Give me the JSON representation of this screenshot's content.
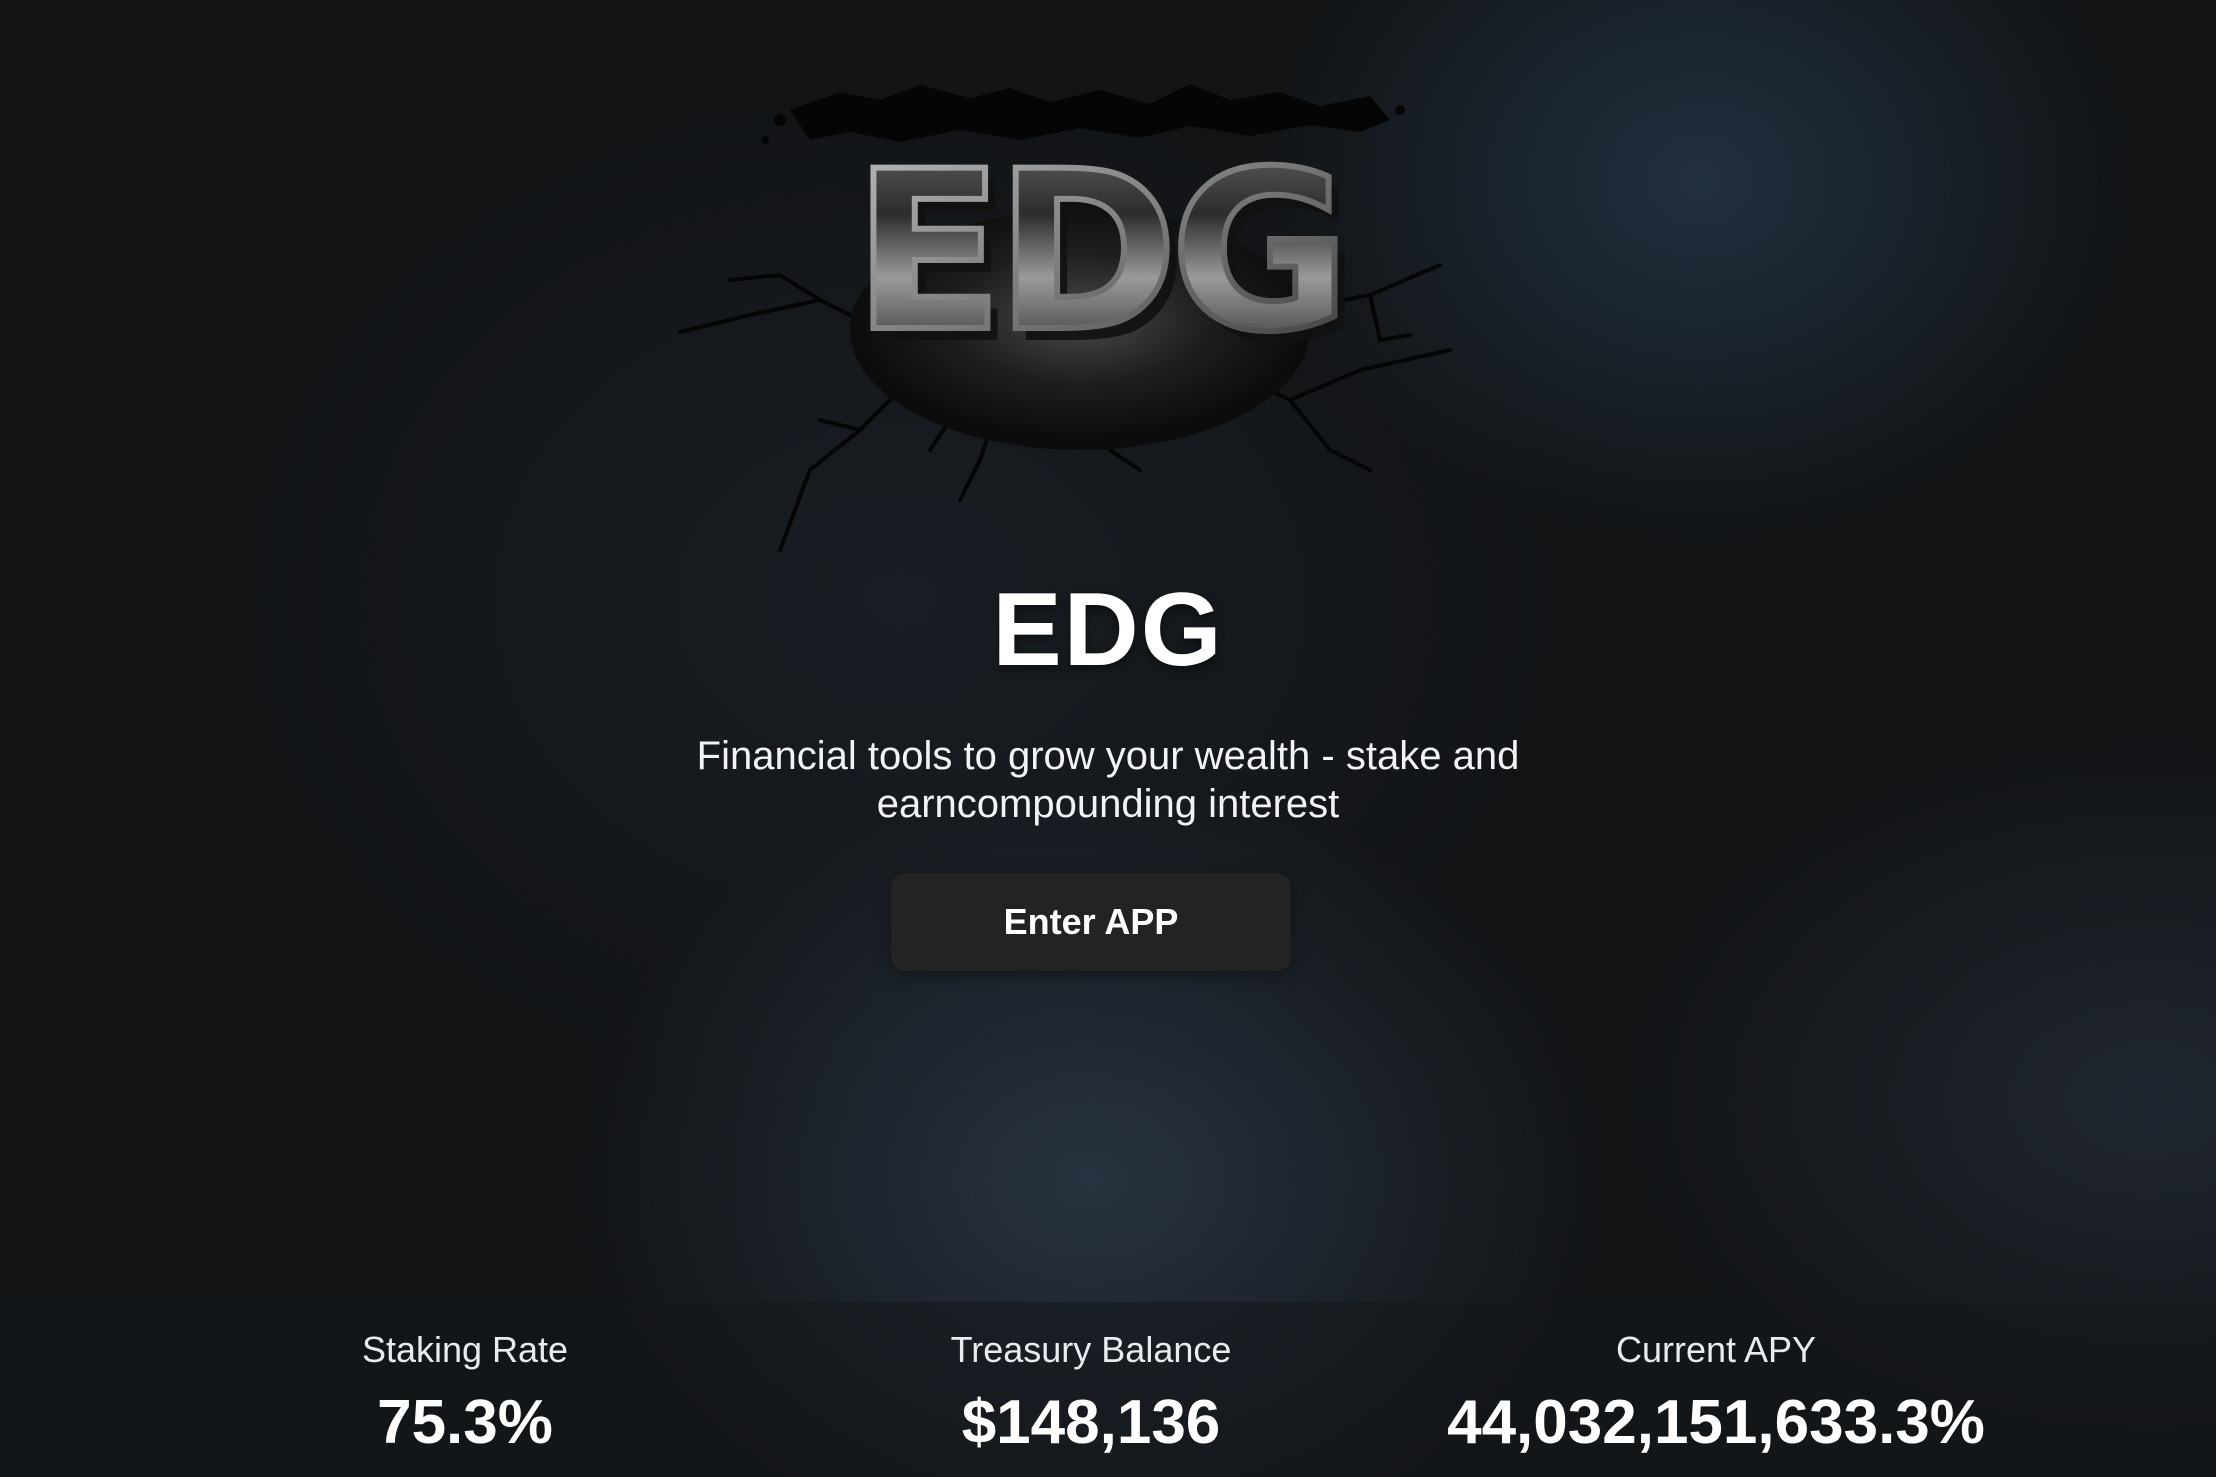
{
  "brand": {
    "logo_text": "EDG",
    "title": "EDG",
    "tagline": "Financial tools to grow your wealth - stake and earncompounding interest"
  },
  "cta": {
    "enter_label": "Enter APP"
  },
  "stats": [
    {
      "label": "Staking Rate",
      "value": "75.3%"
    },
    {
      "label": "Treasury Balance",
      "value": "$148,136"
    },
    {
      "label": "Current APY",
      "value": "44,032,151,633.3%"
    }
  ],
  "colors": {
    "background": "#121416",
    "button": "#232323",
    "text": "#ffffff"
  }
}
